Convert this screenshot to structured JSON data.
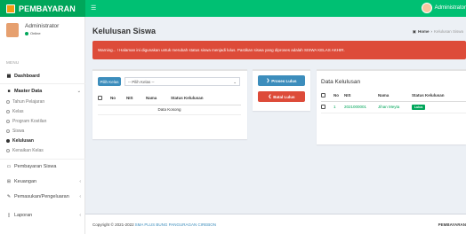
{
  "app": {
    "brand": "PEMBAYARAN",
    "top_user": "Administrator"
  },
  "user_panel": {
    "name": "Administrator",
    "status": "Online"
  },
  "sidebar": {
    "header": "MENU",
    "dashboard": "Dashboard",
    "master_data": "Master Data",
    "sub_items": [
      "Tahun Pelajaran",
      "Kelas",
      "Program Kostilan",
      "Siswa",
      "Kelulusan",
      "Kenaikan Kelas"
    ],
    "pembayaran": "Pembayaran Siswa",
    "keuangan": "Keuangan",
    "pemasukan": "Pemasukan/Pengeluaran",
    "laporan": "Laporan"
  },
  "page": {
    "title": "Kelulusan Siswa"
  },
  "breadcrumb": {
    "home": "Home",
    "current": "Kelulusan Siswa"
  },
  "alert": {
    "text": "Warning... ! Halaman ini digunakan untuk merubah status siswa menjadi lulus. Pastikan siswa yang diproses adalah SISWA KELAS AKHIR."
  },
  "filter": {
    "button": "Pilih Kelas",
    "select_value": "-- Pilih Kelas --"
  },
  "left_table": {
    "headers": [
      "No",
      "NIS",
      "Nama",
      "Status Kelulusan"
    ],
    "empty": "Data Kosong"
  },
  "actions": {
    "proses": "Proses Lulus",
    "batal": "Batal Lulus"
  },
  "right_box": {
    "title": "Data Kelulusan",
    "headers": [
      "No",
      "NIS",
      "Nama",
      "Status Kelulusan"
    ],
    "rows": [
      {
        "no": "1",
        "nis": "2021000001",
        "nama": "Jihan Meyta",
        "status": "Lulus"
      }
    ]
  },
  "footer": {
    "prefix": "Copyright © 2021-2022",
    "link": "SMA PLUS BUNG PANGURAGAN CIREBON",
    "right": "PEMBAYARAN"
  },
  "colors": {
    "brand": "#00a65a",
    "topbar": "#00c073",
    "alert": "#dd4b39",
    "primary": "#3c8dbc"
  }
}
